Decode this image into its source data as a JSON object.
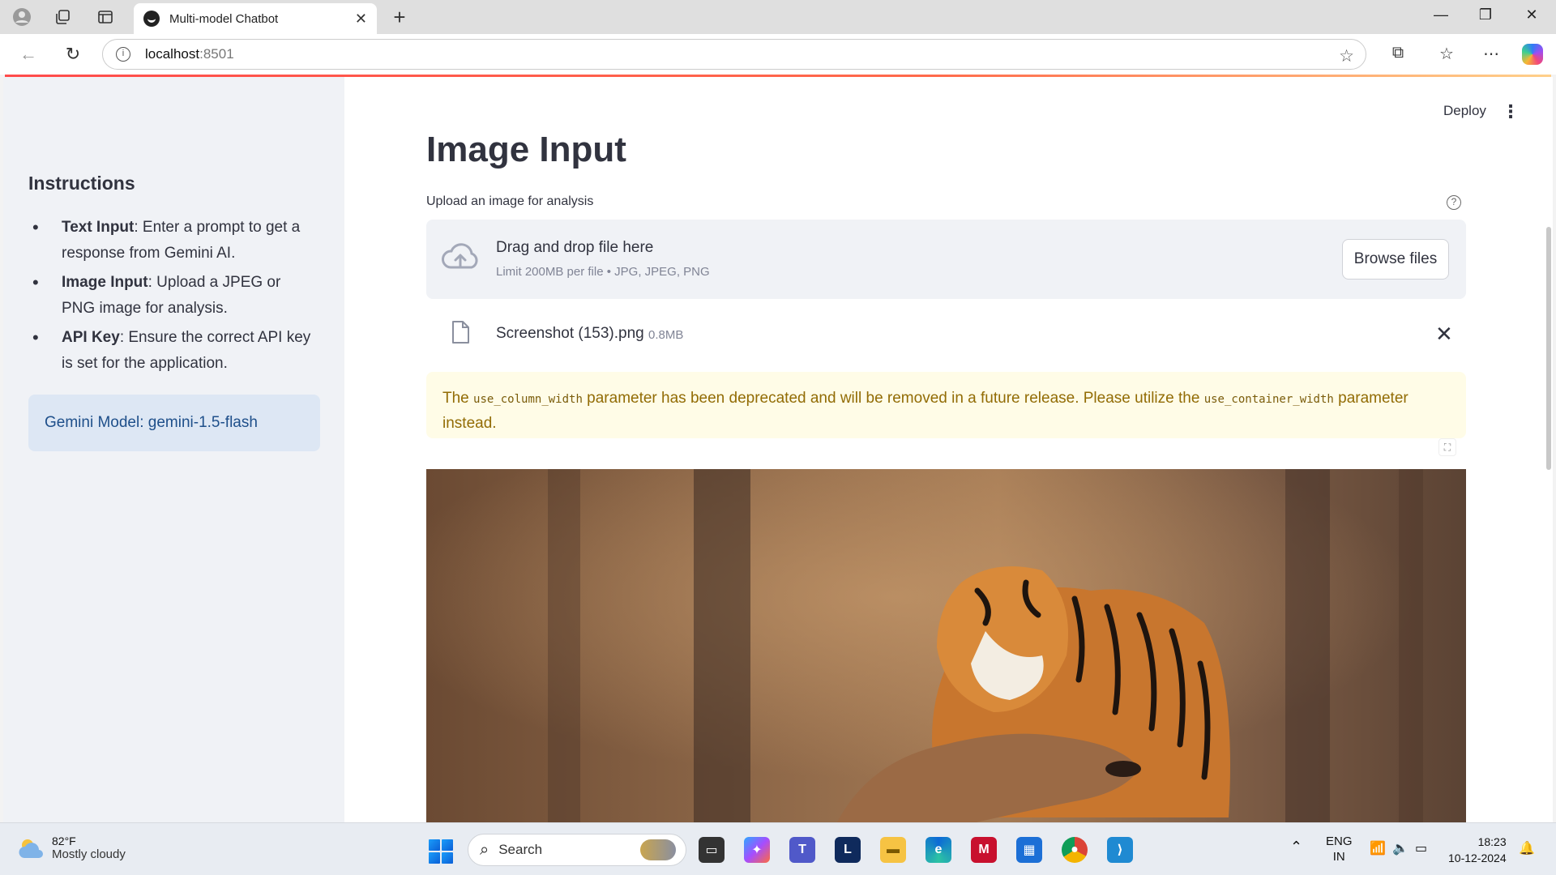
{
  "browser": {
    "tab_title": "Multi-model Chatbot",
    "url_host": "localhost",
    "url_port": ":8501"
  },
  "sidebar": {
    "title": "Instructions",
    "items": [
      {
        "term": "Text Input",
        "desc": ": Enter a prompt to get a response from Gemini AI."
      },
      {
        "term": "Image Input",
        "desc": ": Upload a JPEG or PNG image for analysis."
      },
      {
        "term": "API Key",
        "desc": ": Ensure the correct API key is set for the application."
      }
    ],
    "model_info": "Gemini Model: gemini-1.5-flash"
  },
  "header": {
    "deploy_label": "Deploy"
  },
  "main": {
    "title": "Image Input",
    "uploader_label": "Upload an image for analysis",
    "dropzone_text": "Drag and drop file here",
    "dropzone_limit": "Limit 200MB per file • JPG, JPEG, PNG",
    "browse_label": "Browse files",
    "uploaded_file": {
      "name": "Screenshot (153).png",
      "size": "0.8MB"
    },
    "warning": {
      "prefix": "The ",
      "param1": "use_column_width",
      "middle": " parameter has been deprecated and will be removed in a future release. Please utilize the ",
      "param2": "use_container_width",
      "suffix": " parameter instead."
    }
  },
  "taskbar": {
    "weather_temp": "82°F",
    "weather_desc": "Mostly cloudy",
    "search_label": "Search",
    "lang_line1": "ENG",
    "lang_line2": "IN",
    "time": "18:23",
    "date": "10-12-2024"
  },
  "colors": {
    "accent": "#ff4b4b",
    "info_bg": "#dde7f4",
    "warning_bg": "#fffce7"
  }
}
